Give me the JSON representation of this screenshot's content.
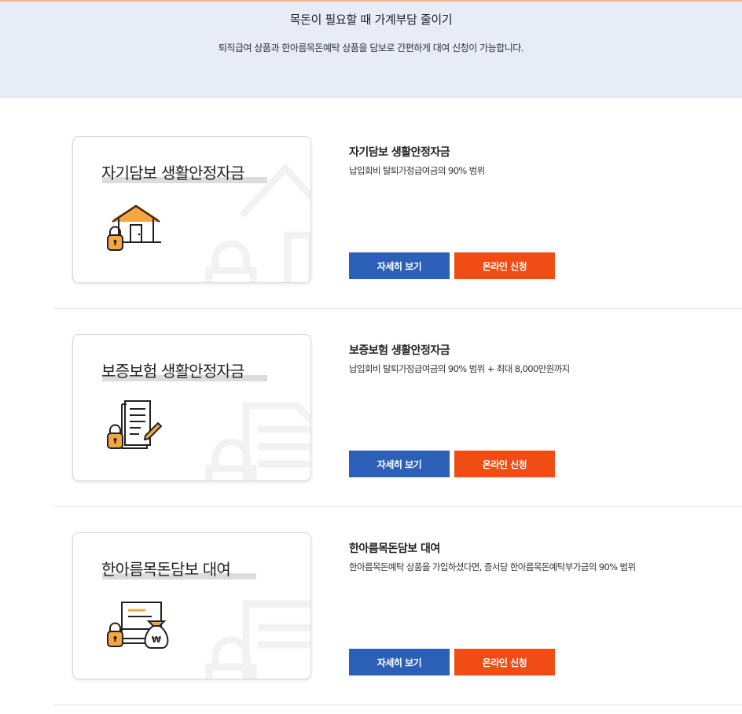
{
  "banner": {
    "title": "목돈이 필요할 때 가계부담 줄이기",
    "subtitle": "퇴직급여 상품과 한아름목돈예탁 상품을 담보로 간편하게 대여 신청이 가능합니다."
  },
  "products": [
    {
      "card_title": "자기담보 생활안정자금",
      "title": "자기담보 생활안정자금",
      "description": "납입회비 탈퇴가정급여금의 90% 범위",
      "detail_label": "자세히 보기",
      "apply_label": "온라인 신청",
      "icon": "house-lock-icon"
    },
    {
      "card_title": "보증보험 생활안정자금",
      "title": "보증보험 생활안정자금",
      "description": "납입회비 탈퇴가정급여금의 90% 범위 + 최대 8,000만원까지",
      "detail_label": "자세히 보기",
      "apply_label": "온라인 신청",
      "icon": "document-lock-icon"
    },
    {
      "card_title": "한아름목돈담보 대여",
      "title": "한아름목돈담보 대여",
      "description": "한아름목돈예탁 상품을 가입하셨다면, 증서당 한아름목돈예탁부가금의 90% 범위",
      "detail_label": "자세히 보기",
      "apply_label": "온라인 신청",
      "icon": "certificate-money-lock-icon"
    }
  ],
  "colors": {
    "banner_bg": "#e8ecf6",
    "detail_button": "#2b5fb8",
    "apply_button": "#f04c14",
    "icon_accent": "#f5a542"
  }
}
